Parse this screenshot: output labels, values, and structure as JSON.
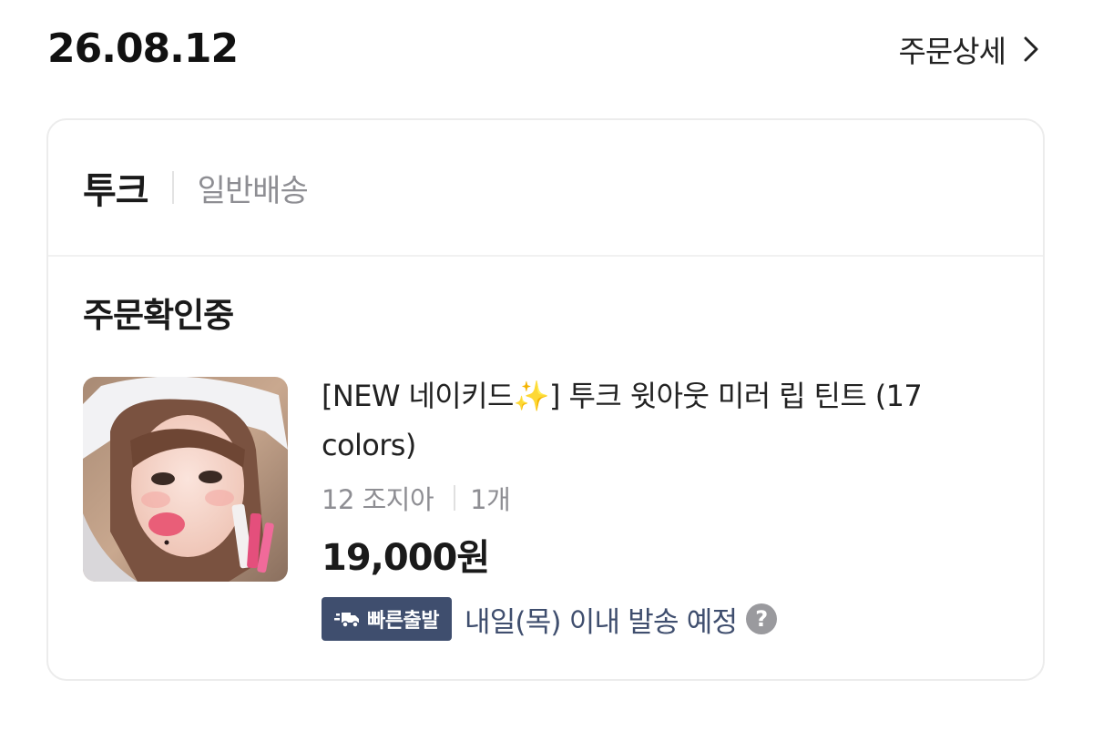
{
  "order": {
    "date": "26.08.12",
    "detail_label": "주문상세",
    "brand": "투크",
    "shipping_type": "일반배송",
    "status": "주문확인중",
    "product": {
      "name": "[NEW 네이키드✨] 투크 윗아웃 미러 립 틴트 (17 colors)",
      "option": "12 조지아",
      "quantity": "1개",
      "price": "19,000원",
      "badge_label": "빠른출발",
      "delivery_text": "내일(목) 이내 발송 예정",
      "help_symbol": "?"
    }
  },
  "colors": {
    "badge_bg": "#3f4e6e",
    "delivery_text": "#3f4e6e",
    "muted_text": "#8e8e93"
  },
  "icons": {
    "detail_chevron": "chevron-right-icon",
    "badge_icon": "truck-icon",
    "help": "help-icon"
  }
}
